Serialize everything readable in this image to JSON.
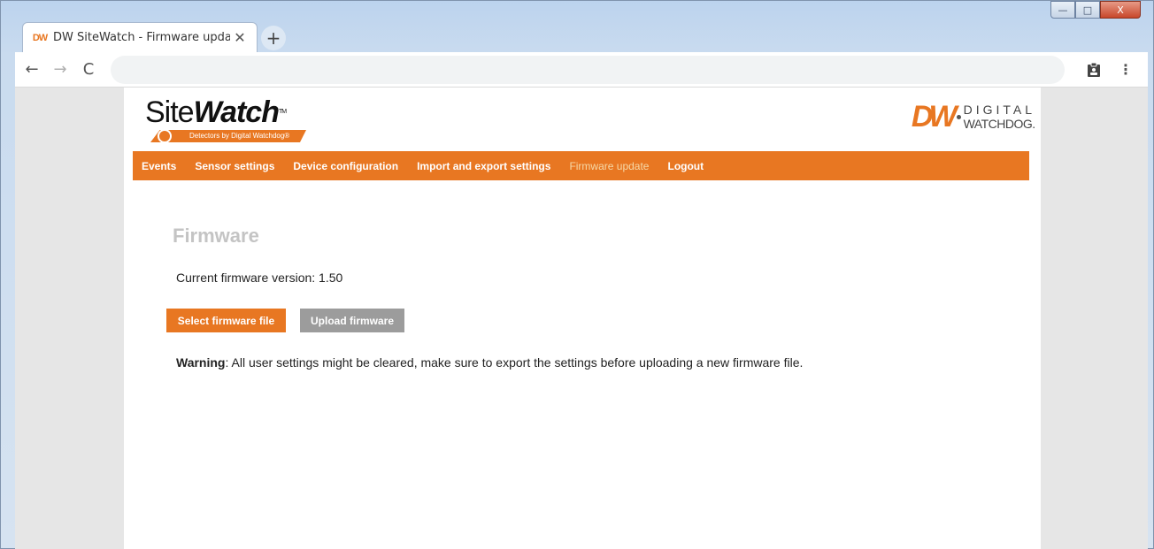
{
  "browser": {
    "tab_favicon": "DW",
    "tab_title": "DW SiteWatch - Firmware update",
    "tab_close": "✕",
    "new_tab": "+",
    "back": "←",
    "forward": "→",
    "reload": "C",
    "menu": "⋮",
    "window_min": "—",
    "window_max": "□",
    "window_close": "X"
  },
  "header": {
    "brand_site": "Site",
    "brand_watch": "Watch",
    "brand_tm": "TM",
    "tagline": "Detectors by Digital Watchdog®",
    "dw_mark": "DW",
    "dw_line1": "DIGITAL",
    "dw_line2": "WATCHDOG."
  },
  "nav": {
    "items": [
      "Events",
      "Sensor settings",
      "Device configuration",
      "Import and export settings",
      "Firmware update",
      "Logout"
    ],
    "active": "Firmware update"
  },
  "main": {
    "title": "Firmware",
    "version_label": "Current firmware version: ",
    "version_value": "1.50",
    "select_button": "Select firmware file",
    "upload_button": "Upload firmware",
    "warning_label": "Warning",
    "warning_text": ": All user settings might be cleared, make sure to export the settings before uploading a new firmware file."
  },
  "colors": {
    "accent": "#e87722",
    "disabled_button": "#9c9c9c",
    "title_grey": "#c4c4c4"
  }
}
